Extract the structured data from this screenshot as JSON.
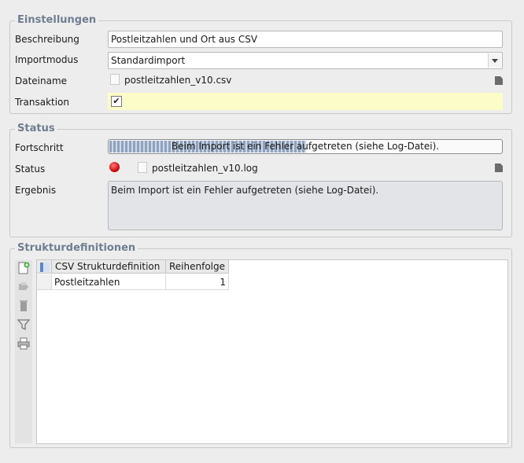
{
  "settings": {
    "legend": "Einstellungen",
    "description_label": "Beschreibung",
    "description_value": "Postleitzahlen und Ort aus CSV",
    "import_mode_label": "Importmodus",
    "import_mode_value": "Standardimport",
    "filename_label": "Dateiname",
    "filename_value": "postleitzahlen_v10.csv",
    "transaction_label": "Transaktion",
    "transaction_checked": true,
    "check_glyph": "✔"
  },
  "status": {
    "legend": "Status",
    "progress_label": "Fortschritt",
    "progress_text": "Beim Import ist ein Fehler aufgetreten (siehe Log-Datei).",
    "progress_fraction": 0.5,
    "status_label": "Status",
    "status_color": "#c40000",
    "log_file": "postleitzahlen_v10.log",
    "result_label": "Ergebnis",
    "result_text": "Beim Import ist ein Fehler aufgetreten (siehe Log-Datei)."
  },
  "structure": {
    "legend": "Strukturdefinitionen",
    "columns": [
      "CSV Strukturdefinition",
      "Reihenfolge"
    ],
    "rows": [
      {
        "name": "Postleitzahlen",
        "order": "1"
      }
    ],
    "tools": [
      "add-icon",
      "edit-icon",
      "delete-icon",
      "filter-icon",
      "print-icon"
    ]
  }
}
